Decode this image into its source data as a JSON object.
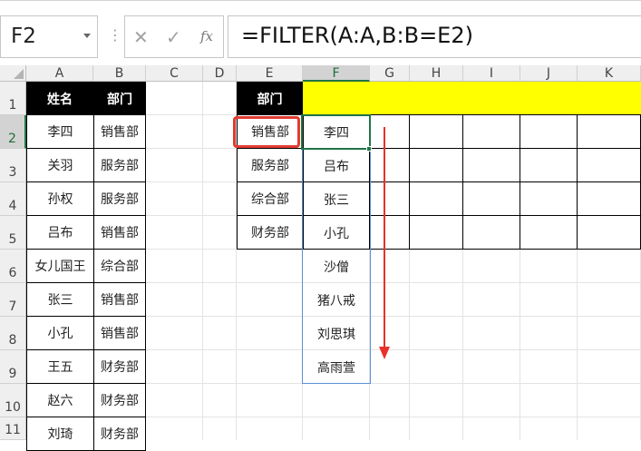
{
  "formula_bar": {
    "name_box": "F2",
    "cancel_icon": "✕",
    "enter_icon": "✓",
    "fx_icon": "fx",
    "formula": "=FILTER(A:A,B:B=E2)"
  },
  "columns": [
    "A",
    "B",
    "C",
    "D",
    "E",
    "F",
    "G",
    "H",
    "I",
    "J",
    "K"
  ],
  "rows": [
    "1",
    "2",
    "3",
    "4",
    "5",
    "6",
    "7",
    "8",
    "9",
    "10",
    "11"
  ],
  "source_table": {
    "headers": [
      "姓名",
      "部门"
    ],
    "rows": [
      [
        "李四",
        "销售部"
      ],
      [
        "关羽",
        "服务部"
      ],
      [
        "孙权",
        "服务部"
      ],
      [
        "吕布",
        "销售部"
      ],
      [
        "女儿国王",
        "综合部"
      ],
      [
        "张三",
        "销售部"
      ],
      [
        "小孔",
        "销售部"
      ],
      [
        "王五",
        "财务部"
      ],
      [
        "赵六",
        "财务部"
      ],
      [
        "刘琦",
        "财务部"
      ]
    ]
  },
  "dept_table": {
    "header": "部门",
    "items": [
      "销售部",
      "服务部",
      "综合部",
      "财务部"
    ]
  },
  "spill_results": [
    "李四",
    "吕布",
    "张三",
    "小孔",
    "沙僧",
    "猪八戒",
    "刘思琪",
    "高雨萱"
  ],
  "colors": {
    "yellow_fill": "#ffff00",
    "highlight_red": "#e03c31",
    "arrow_red": "#e8312a",
    "select_green": "#217346"
  }
}
